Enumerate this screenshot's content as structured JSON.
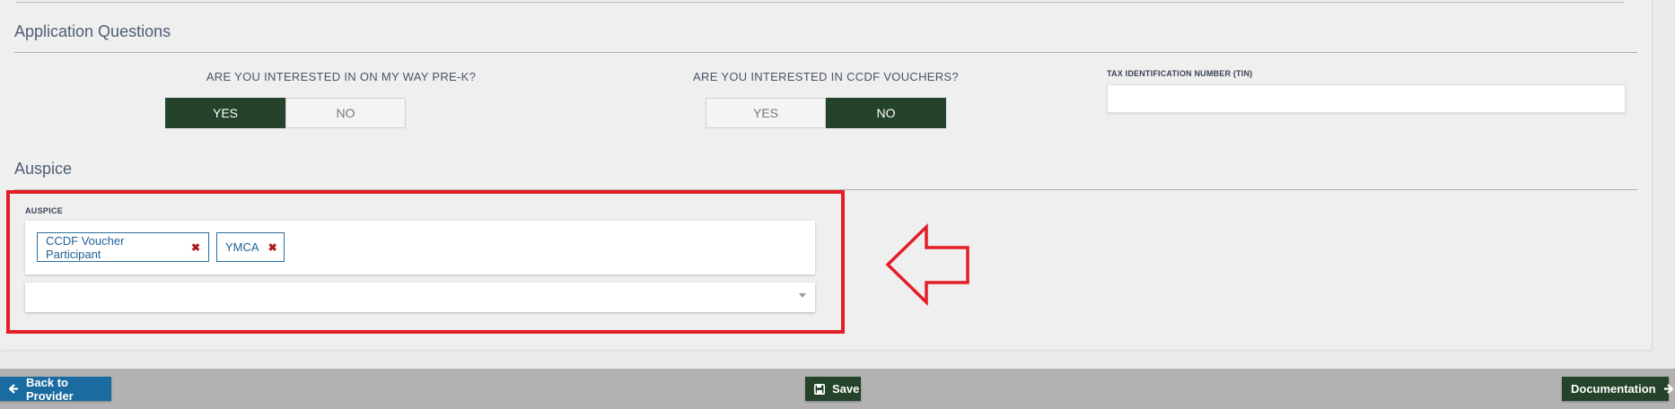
{
  "sections": {
    "application_questions": "Application Questions",
    "auspice": "Auspice"
  },
  "questions": {
    "prek": {
      "label": "ARE YOU INTERESTED IN ON MY WAY PRE-K?",
      "yes": "YES",
      "no": "NO",
      "selected": "YES"
    },
    "ccdf": {
      "label": "ARE YOU INTERESTED IN CCDF VOUCHERS?",
      "yes": "YES",
      "no": "NO",
      "selected": "NO"
    },
    "tin": {
      "label": "TAX IDENTIFICATION NUMBER (TIN)",
      "value": ""
    }
  },
  "auspice": {
    "label": "AUSPICE",
    "tags": [
      "CCDF Voucher Participant",
      "YMCA"
    ],
    "remove_glyph": "✖",
    "dropdown_value": ""
  },
  "footer": {
    "back_label": "Back to Provider",
    "save_label": "Save",
    "documentation_label": "Documentation"
  },
  "colors": {
    "selected_toggle": "#24432a",
    "back_button": "#1a6ba0",
    "save_button": "#24432a",
    "highlight": "#e41e26",
    "tag_border": "#2f6f9f",
    "tag_remove": "#b01b1b"
  },
  "icons": {
    "back": "arrow-left-icon",
    "save": "floppy-disk-icon",
    "documentation": "arrow-right-icon",
    "annotation": "outline-arrow-left-icon",
    "dropdown": "caret-down-icon"
  }
}
